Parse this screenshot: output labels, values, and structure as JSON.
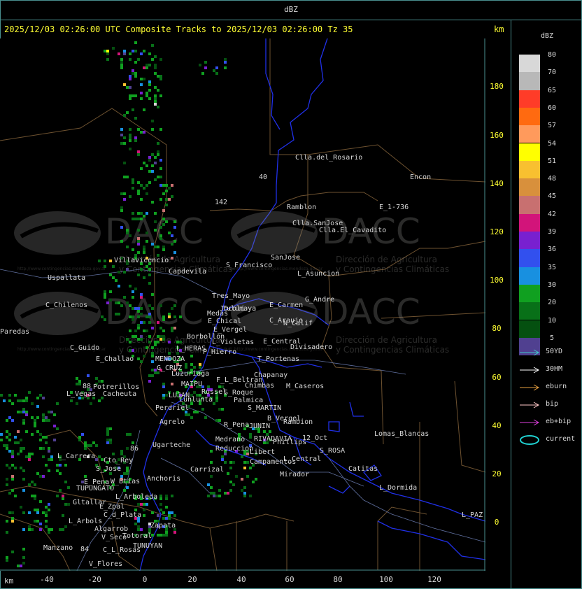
{
  "title": "dBZ",
  "header": "2025/12/03 02:26:00 UTC Composite Tracks to 2025/12/03 02:26:00 Tz 35",
  "km_label": "km",
  "y_ticks": [
    "180",
    "160",
    "140",
    "120",
    "100",
    "80",
    "60",
    "40",
    "20",
    "0"
  ],
  "x_ticks": [
    "-40",
    "-20",
    "0",
    "20",
    "40",
    "60",
    "80",
    "100",
    "120"
  ],
  "legend": {
    "title": "dBZ",
    "levels": [
      {
        "label": "80",
        "color": "#d8d8d8"
      },
      {
        "label": "70",
        "color": "#b8b8b8"
      },
      {
        "label": "65",
        "color": "#ff3c28"
      },
      {
        "label": "60",
        "color": "#ff6a10"
      },
      {
        "label": "57",
        "color": "#ff9a5c"
      },
      {
        "label": "54",
        "color": "#ffff00"
      },
      {
        "label": "51",
        "color": "#f8c030"
      },
      {
        "label": "48",
        "color": "#d8903c"
      },
      {
        "label": "45",
        "color": "#c87070"
      },
      {
        "label": "42",
        "color": "#d2147a"
      },
      {
        "label": "39",
        "color": "#7820d0"
      },
      {
        "label": "36",
        "color": "#3250ee"
      },
      {
        "label": "35",
        "color": "#1890e0"
      },
      {
        "label": "30",
        "color": "#10a020"
      },
      {
        "label": "20",
        "color": "#087018"
      },
      {
        "label": "10",
        "color": "#055010"
      },
      {
        "label": "5",
        "color": "#504090"
      }
    ],
    "tracks": [
      {
        "label": "50YD",
        "color": "#40c8c8"
      },
      {
        "label": "30HM",
        "color": "#ffffff"
      },
      {
        "label": "eburn",
        "color": "#e8a040"
      },
      {
        "label": "bip",
        "color": "#ffc8c8"
      },
      {
        "label": "eb+bip",
        "color": "#e040e0"
      },
      {
        "label": "current",
        "color": "#20d0d0"
      }
    ]
  },
  "watermark": {
    "text": "DACC",
    "line1": "Dirección de Agricultura",
    "line2": "y Contingencias Climáticas",
    "url": "http://www.contingencias.mendoza.gov.ar"
  },
  "places": [
    "Clla.del_Rosario",
    "Encon",
    "142",
    "E_1-736",
    "Ramblon",
    "40",
    "Clla.SanJose",
    "Clla.El_Cavadito",
    "Villavicencio",
    "S_Francisco",
    "SanJose",
    "Uspallata",
    "Capdevila",
    "L_Asuncion",
    "Tres_Mayo",
    "Jocoli",
    "C_Chilenos",
    "Tulumaya",
    "E_Carmen",
    "G_Andre",
    "E_Chical",
    "C_Araujo",
    "Medas",
    "E_Vergel",
    "N_Calif",
    "Borbollon",
    "L_Violetas",
    "E_Central",
    "Divisadero",
    "C_Guido",
    "L_HERAS",
    "P_Hierro",
    "E_Challao",
    "MENDOZA",
    "T_Portenas",
    "G_CRUZ",
    "Luzuriaga",
    "Chapanay",
    "F_L_Beltran",
    "Chimbas",
    "M_Caseros",
    "MAIPU",
    "Russel",
    "S_Roque",
    "Potrerillos",
    "L_Vegas",
    "Cacheuta",
    "LUJAN",
    "Palmica",
    "Perdriel",
    "Lunlunta",
    "S_MARTIN",
    "Agrelo",
    "B_Vergel",
    "Rambion",
    "R_Pena",
    "JUNIN",
    "Medrano",
    "RIVADAVIA",
    "Phillips",
    "Lomas_Blancas",
    "12_Oct",
    "Ugarteche",
    "Reduccion",
    "Libert",
    "S_ROSA",
    "L_Carrera",
    "Cto_Rey",
    "S_Jose",
    "Campamentos",
    "L_Central",
    "Carrizal",
    "Catitas",
    "Mirador",
    "W_Btias",
    "Anchoris",
    "E_Pena",
    "TUPUNGATO",
    "L_Dormida",
    "L_Arboleda",
    "Gltallar",
    "E_Zpal",
    "C_d_Plata",
    "L_Arbols",
    "Algarrob",
    "Zapata",
    "V_Seco",
    "Totoral",
    "L_PAZ",
    "TUNUYAN",
    "Manzano",
    "C_L_Rosas",
    "V_Flores",
    "Paredas",
    "88",
    "86",
    "84"
  ]
}
